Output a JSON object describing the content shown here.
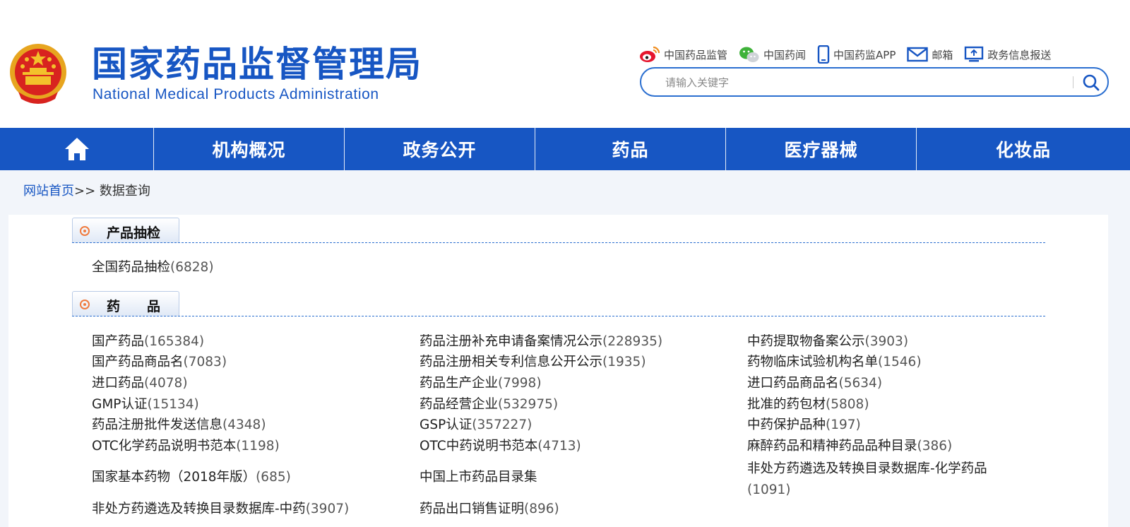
{
  "header": {
    "title_cn": "国家药品监督管理局",
    "title_en": "National Medical Products Administration",
    "emblem_icon": "national-emblem-icon"
  },
  "toplinks": [
    {
      "label": "中国药品监管",
      "icon": "weibo-icon"
    },
    {
      "label": "中国药闻",
      "icon": "wechat-icon"
    },
    {
      "label": "中国药监APP",
      "icon": "mobile-phone-icon"
    },
    {
      "label": "邮箱",
      "icon": "mail-icon"
    },
    {
      "label": "政务信息报送",
      "icon": "monitor-upload-icon"
    }
  ],
  "search": {
    "placeholder": "请输入关键字",
    "value": "",
    "icon": "search-icon"
  },
  "nav": {
    "home_icon": "home-icon",
    "items": [
      "机构概况",
      "政务公开",
      "药品",
      "医疗器械",
      "化妆品"
    ]
  },
  "breadcrumb": {
    "home": "网站首页",
    "separator": ">>",
    "current": "数据查询"
  },
  "sections": [
    {
      "title": "产品抽检",
      "links": [
        {
          "name": "全国药品抽检",
          "count": "(6828)"
        }
      ]
    },
    {
      "title": "药　　品",
      "links": [
        {
          "name": "国产药品",
          "count": "(165384)"
        },
        {
          "name": "国产药品商品名",
          "count": "(7083)"
        },
        {
          "name": "进口药品",
          "count": "(4078)"
        },
        {
          "name": "GMP认证",
          "count": "(15134)"
        },
        {
          "name": "药品注册批件发送信息",
          "count": "(4348)"
        },
        {
          "name": "OTC化学药品说明书范本",
          "count": "(1198)"
        },
        {
          "name": "国家基本药物（2018年版）",
          "count": "(685)"
        },
        {
          "name": "非处方药遴选及转换目录数据库-中药",
          "count": "(3907)"
        },
        {
          "name": "药品注册补充申请备案情况公示",
          "count": "(228935)"
        },
        {
          "name": "药品注册相关专利信息公开公示",
          "count": "(1935)"
        },
        {
          "name": "药品生产企业",
          "count": "(7998)"
        },
        {
          "name": "药品经营企业",
          "count": "(532975)"
        },
        {
          "name": "GSP认证",
          "count": "(357227)"
        },
        {
          "name": "OTC中药说明书范本",
          "count": "(4713)"
        },
        {
          "name": "中国上市药品目录集",
          "count": ""
        },
        {
          "name": "药品出口销售证明",
          "count": "(896)"
        },
        {
          "name": "中药提取物备案公示",
          "count": "(3903)"
        },
        {
          "name": "药物临床试验机构名单",
          "count": "(1546)"
        },
        {
          "name": "进口药品商品名",
          "count": "(5634)"
        },
        {
          "name": "批准的药包材",
          "count": "(5808)"
        },
        {
          "name": "中药保护品种",
          "count": "(197)"
        },
        {
          "name": "麻醉药品和精神药品品种目录",
          "count": "(386)"
        },
        {
          "name": "非处方药遴选及转换目录数据库-化学药品",
          "count": "(1091)"
        }
      ]
    }
  ],
  "colors": {
    "brand_blue": "#1756c3",
    "accent_orange": "#f07b3f"
  }
}
